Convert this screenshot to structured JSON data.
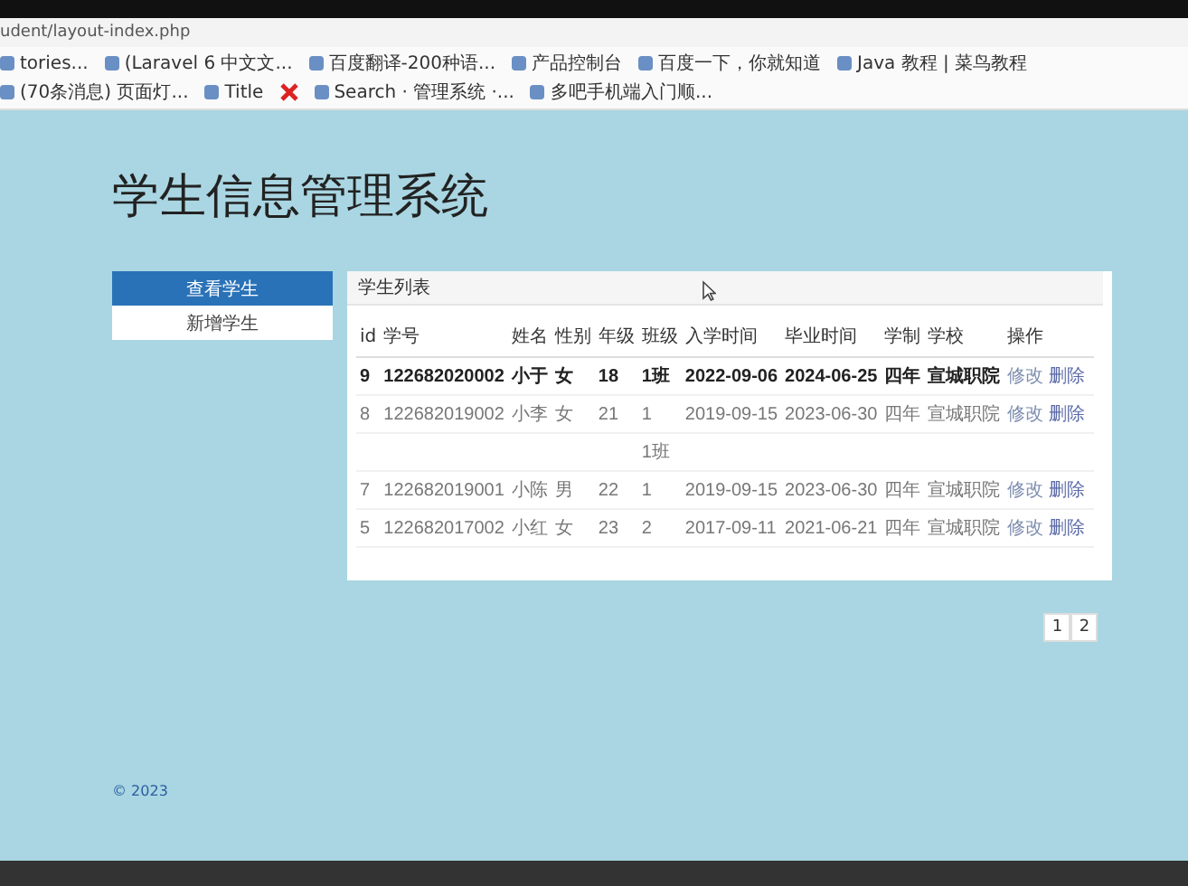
{
  "browser": {
    "url": "udent/layout-index.php",
    "bookmarks": [
      {
        "kind": "text",
        "label": "tories..."
      },
      {
        "kind": "text",
        "label": "(Laravel 6 中文文..."
      },
      {
        "kind": "text",
        "label": "百度翻译-200种语..."
      },
      {
        "kind": "text",
        "label": "产品控制台"
      },
      {
        "kind": "text",
        "label": "百度一下，你就知道"
      },
      {
        "kind": "text",
        "label": "Java 教程 | 菜鸟教程"
      },
      {
        "kind": "text",
        "label": "(70条消息) 页面灯..."
      },
      {
        "kind": "text",
        "label": "Title"
      },
      {
        "kind": "icon"
      },
      {
        "kind": "text",
        "label": "Search · 管理系统 ·..."
      },
      {
        "kind": "text",
        "label": "多吧手机端入门顺..."
      }
    ]
  },
  "page_title": "学生信息管理系统",
  "sidebar": {
    "items": [
      {
        "label": "查看学生",
        "selected": true
      },
      {
        "label": "新增学生",
        "selected": false
      }
    ]
  },
  "panel": {
    "title": "学生列表",
    "table": {
      "columns": [
        "id",
        "学号",
        "姓名",
        "性别",
        "年级",
        "班级",
        "入学时间",
        "毕业时间",
        "学制",
        "学校",
        "操作"
      ],
      "rows": [
        {
          "selected": true,
          "cells": [
            "9",
            "122682020002",
            "小于",
            "女",
            "18",
            "1班",
            "2022-09-06",
            "2024-06-25",
            "四年",
            "宣城职院"
          ],
          "actions": [
            "修改",
            "删除"
          ]
        },
        {
          "selected": false,
          "cells": [
            "8",
            "122682019002",
            "小李",
            "女",
            "21",
            "1",
            "2019-09-15",
            "2023-06-30",
            "四年",
            "宣城职院"
          ],
          "actions": [
            "修改",
            "删除"
          ]
        },
        {
          "selected": false,
          "cells": [
            null,
            null,
            null,
            null,
            null,
            "1班",
            null,
            null,
            null,
            null
          ],
          "actions": []
        },
        {
          "selected": false,
          "cells": [
            "7",
            "122682019001",
            "小陈",
            "男",
            "22",
            "1",
            "2019-09-15",
            "2023-06-30",
            "四年",
            "宣城职院"
          ],
          "actions": [
            "修改",
            "删除"
          ]
        },
        {
          "selected": false,
          "cells": [
            "5",
            "122682017002",
            "小红",
            "女",
            "23",
            "2",
            "2017-09-11",
            "2021-06-21",
            "四年",
            "宣城职院"
          ],
          "actions": [
            "修改",
            "删除"
          ]
        }
      ]
    }
  },
  "pagination": [
    "1",
    "2"
  ],
  "footer": "© 2023"
}
